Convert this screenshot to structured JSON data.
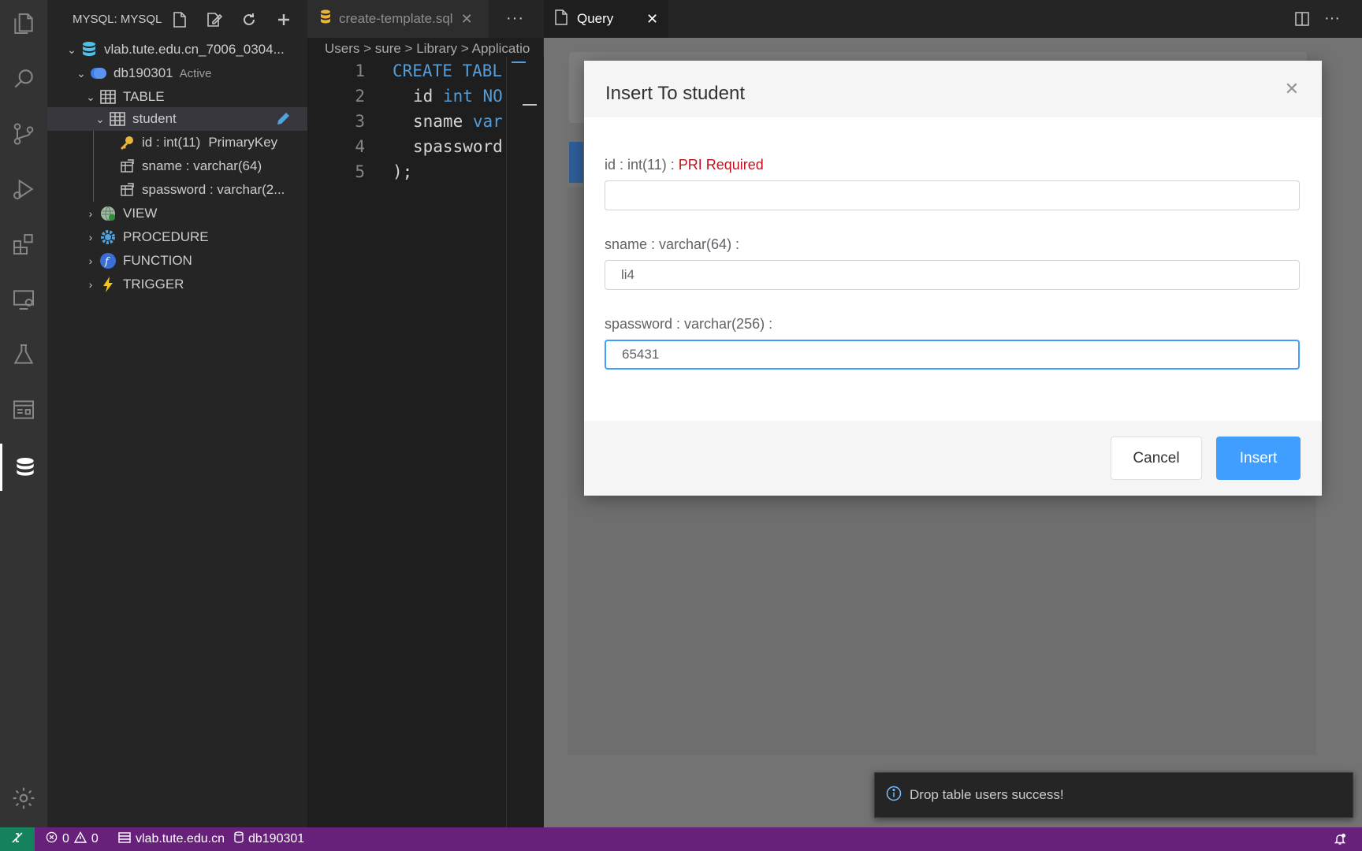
{
  "sidebar": {
    "title": "MYSQL: MYSQL",
    "tree": {
      "connection": "vlab.tute.edu.cn_7006_0304...",
      "database": "db190301",
      "database_badge": "Active",
      "table_group": "TABLE",
      "table": "student",
      "columns": [
        {
          "name": "id : int(11)",
          "extra": "PrimaryKey"
        },
        {
          "name": "sname : varchar(64)",
          "extra": ""
        },
        {
          "name": "spassword : varchar(2...",
          "extra": ""
        }
      ],
      "view": "VIEW",
      "procedure": "PROCEDURE",
      "function": "FUNCTION",
      "trigger": "TRIGGER"
    }
  },
  "editor": {
    "tab_label": "create-template.sql",
    "breadcrumb": "Users > sure > Library > Applicatio",
    "lines": [
      {
        "num": "1",
        "text_kw": "CREATE TABL",
        "text": ""
      },
      {
        "num": "2",
        "text": "  id ",
        "text_kw": "int NO"
      },
      {
        "num": "3",
        "text": "  sname ",
        "text_kw": "var"
      },
      {
        "num": "4",
        "text": "  spassword",
        "text_kw": ""
      },
      {
        "num": "5",
        "text": ");",
        "text_kw": ""
      }
    ]
  },
  "query": {
    "tab_label": "Query"
  },
  "modal": {
    "title": "Insert To student",
    "fields": [
      {
        "label": "id : int(11) :",
        "required": "PRI Required",
        "value": ""
      },
      {
        "label": "sname : varchar(64) :",
        "required": "",
        "value": "li4"
      },
      {
        "label": "spassword : varchar(256) :",
        "required": "",
        "value": "65431"
      }
    ],
    "cancel_label": "Cancel",
    "insert_label": "Insert"
  },
  "notification": {
    "message": "Drop table users success!"
  },
  "statusbar": {
    "errors": "0",
    "warnings": "0",
    "host": "vlab.tute.edu.cn",
    "database": "db190301"
  },
  "colors": {
    "statusbar": "#68217a",
    "accent": "#409eff",
    "required": "#c0111f"
  }
}
